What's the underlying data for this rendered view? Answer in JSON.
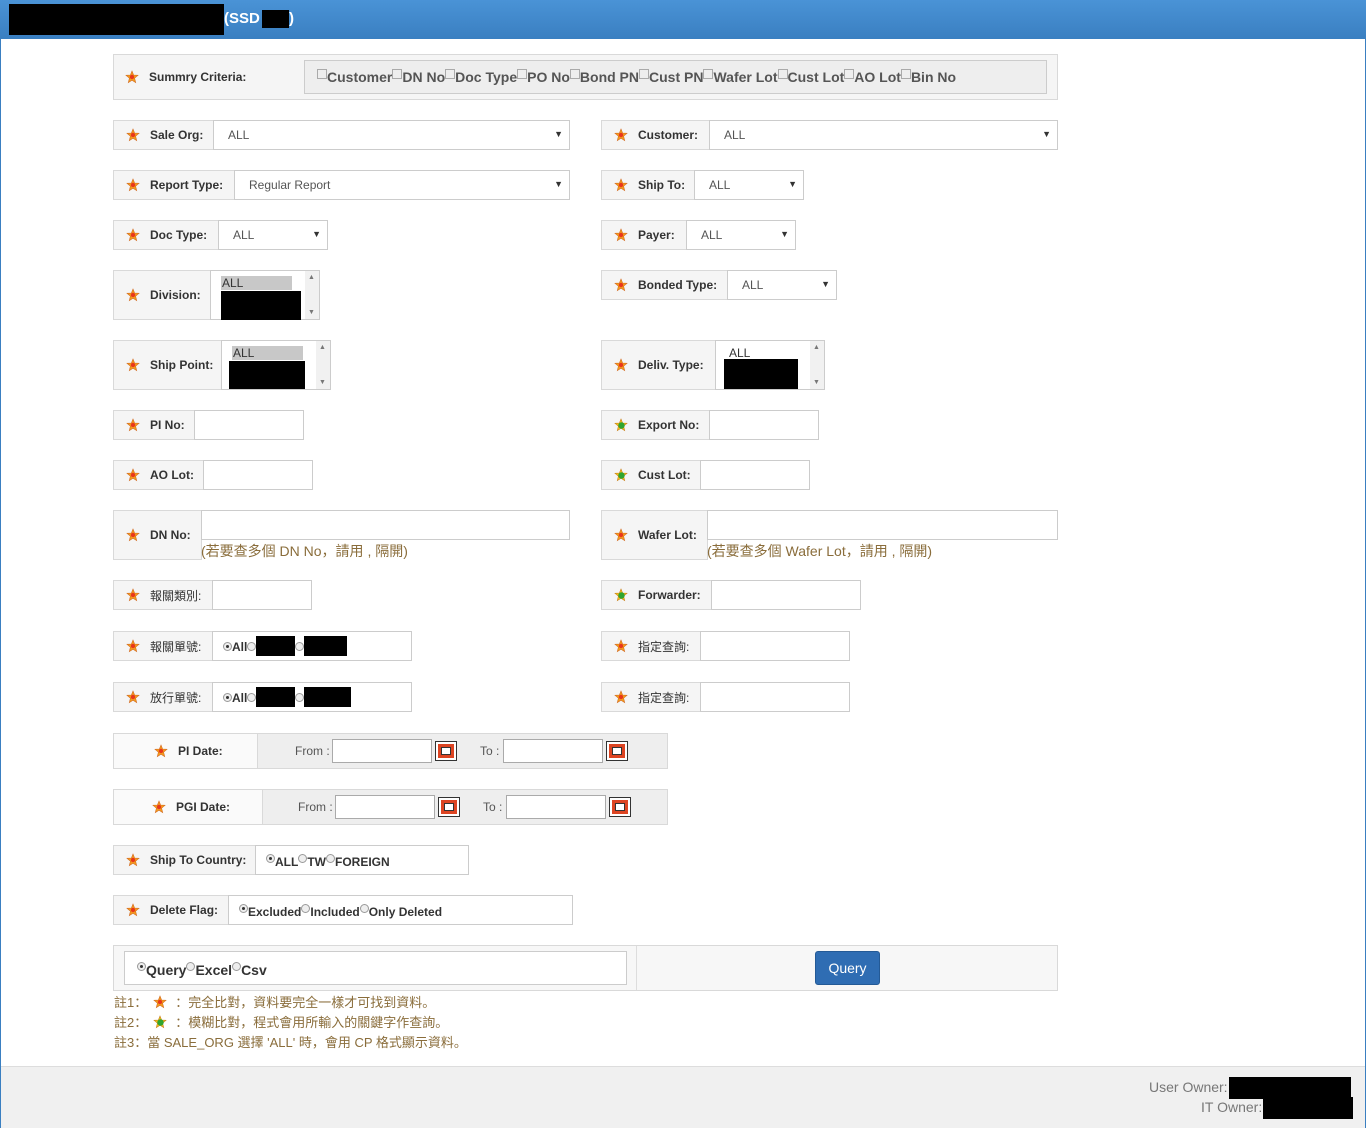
{
  "header": {
    "title_suffix": "(SSD",
    "title_close": ")"
  },
  "summary": {
    "label": "Summry Criteria:",
    "options": [
      "Customer",
      "DN No",
      "Doc Type",
      "PO No",
      "Bond PN",
      "Cust PN",
      "Wafer Lot",
      "Cust Lot",
      "AO Lot",
      "Bin No"
    ]
  },
  "fields": {
    "sale_org": {
      "label": "Sale Org:",
      "value": "ALL"
    },
    "customer": {
      "label": "Customer:",
      "value": "ALL"
    },
    "report_type": {
      "label": "Report Type:",
      "value": "Regular Report"
    },
    "ship_to": {
      "label": "Ship To:",
      "value": "ALL"
    },
    "doc_type": {
      "label": "Doc Type:",
      "value": "ALL"
    },
    "payer": {
      "label": "Payer:",
      "value": "ALL"
    },
    "division": {
      "label": "Division:",
      "selected": "ALL"
    },
    "bonded_type": {
      "label": "Bonded Type:",
      "value": "ALL"
    },
    "ship_point": {
      "label": "Ship Point:",
      "selected": "ALL"
    },
    "deliv_type": {
      "label": "Deliv. Type:",
      "selected": "ALL"
    },
    "pi_no": {
      "label": "PI No:"
    },
    "export_no": {
      "label": "Export No:"
    },
    "ao_lot": {
      "label": "AO Lot:"
    },
    "cust_lot": {
      "label": "Cust Lot:"
    },
    "dn_no": {
      "label": "DN No:",
      "hint": "(若要查多個 DN No，請用 , 隔開)"
    },
    "wafer_lot": {
      "label": "Wafer Lot:",
      "hint": "(若要查多個 Wafer Lot，請用 , 隔開)"
    },
    "customs_category": {
      "label": "報關類別:"
    },
    "forwarder": {
      "label": "Forwarder:"
    },
    "customs_no": {
      "label": "報關單號:",
      "radio_all": "All"
    },
    "query_1": {
      "label": "指定查詢:"
    },
    "release_no": {
      "label": "放行單號:",
      "radio_all": "All"
    },
    "query_2": {
      "label": "指定查詢:"
    },
    "pi_date": {
      "label": "PI Date:",
      "from": "From :",
      "to": "To :"
    },
    "pgi_date": {
      "label": "PGI Date:",
      "from": "From :",
      "to": "To :"
    },
    "ship_to_country": {
      "label": "Ship To Country:",
      "options": [
        "ALL",
        "TW",
        "FOREIGN"
      ]
    },
    "delete_flag": {
      "label": "Delete Flag:",
      "options": [
        "Excluded",
        "Included",
        "Only Deleted"
      ]
    }
  },
  "output": {
    "options": [
      "Query",
      "Excel",
      "Csv"
    ],
    "button": "Query"
  },
  "notes": {
    "n1_prefix": "註1：",
    "n1_text": "：完全比對，資料要完全一樣才可找到資料。",
    "n2_prefix": "註2：",
    "n2_text": "：模糊比對，程式會用所輸入的關鍵字作查詢。",
    "n3": "註3：當 SALE_ORG 選擇 'ALL' 時，會用 CP 格式顯示資料。"
  },
  "footer": {
    "user_owner": "User Owner:",
    "it_owner": "IT Owner:"
  },
  "colors": {
    "title_bar": "#3a7fc1",
    "button": "#2f6db3",
    "hint": "#8a6d3b"
  }
}
